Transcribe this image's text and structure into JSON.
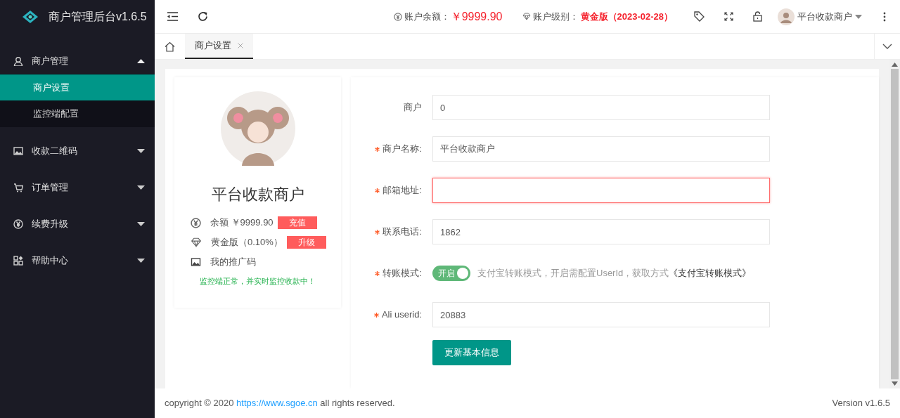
{
  "sidebar": {
    "title": "商户管理后台v1.6.5",
    "items": [
      {
        "label": "商户管理",
        "expanded": true,
        "children": [
          {
            "label": "商户设置",
            "selected": true
          },
          {
            "label": "监控端配置",
            "selected": false
          }
        ]
      },
      {
        "label": "收款二维码",
        "expanded": false
      },
      {
        "label": "订单管理",
        "expanded": false
      },
      {
        "label": "续费升级",
        "expanded": false
      },
      {
        "label": "帮助中心",
        "expanded": false
      }
    ]
  },
  "header": {
    "balance_label": "账户余额：",
    "balance": "￥9999.90",
    "level_label": "账户级别：",
    "level": "黄金版（2023-02-28）",
    "user": "平台收款商户"
  },
  "tabs": [
    {
      "label": "商户设置",
      "selected": true
    }
  ],
  "profile": {
    "name": "平台收款商户",
    "rows": [
      {
        "kind": "balance",
        "text": "余额 ￥9999.90",
        "badge": "充值"
      },
      {
        "kind": "level",
        "text": "黄金版（0.10%）",
        "badge": "升级"
      },
      {
        "kind": "promo",
        "text": "我的推广码"
      }
    ],
    "status": "监控端正常，并实时监控收款中！"
  },
  "form": {
    "fields": [
      {
        "kind": "input",
        "label": "商户",
        "value": "0",
        "required": false,
        "error": false
      },
      {
        "kind": "input",
        "label": "商户名称:",
        "value": "平台收款商户",
        "required": true,
        "error": false
      },
      {
        "kind": "input",
        "label": "邮箱地址:",
        "required": true,
        "error": true
      },
      {
        "kind": "input",
        "label": "联系电话:",
        "value": "1862",
        "required": true,
        "error": false
      },
      {
        "kind": "toggle",
        "label": "转账模式:",
        "required": true,
        "on": true,
        "on_text": "开启",
        "hint": "支付宝转账模式，开启需配置UserId，获取方式",
        "link": "《支付宝转账模式》"
      },
      {
        "kind": "input",
        "label": "Ali userid:",
        "value": "20883",
        "required": true,
        "error": false
      }
    ],
    "submit": "更新基本信息"
  },
  "footer": {
    "copyright": "copyright © 2020",
    "link": "https://www.sgoe.cn",
    "rights": "all rights reserved.",
    "version": "Version v1.6.5"
  }
}
